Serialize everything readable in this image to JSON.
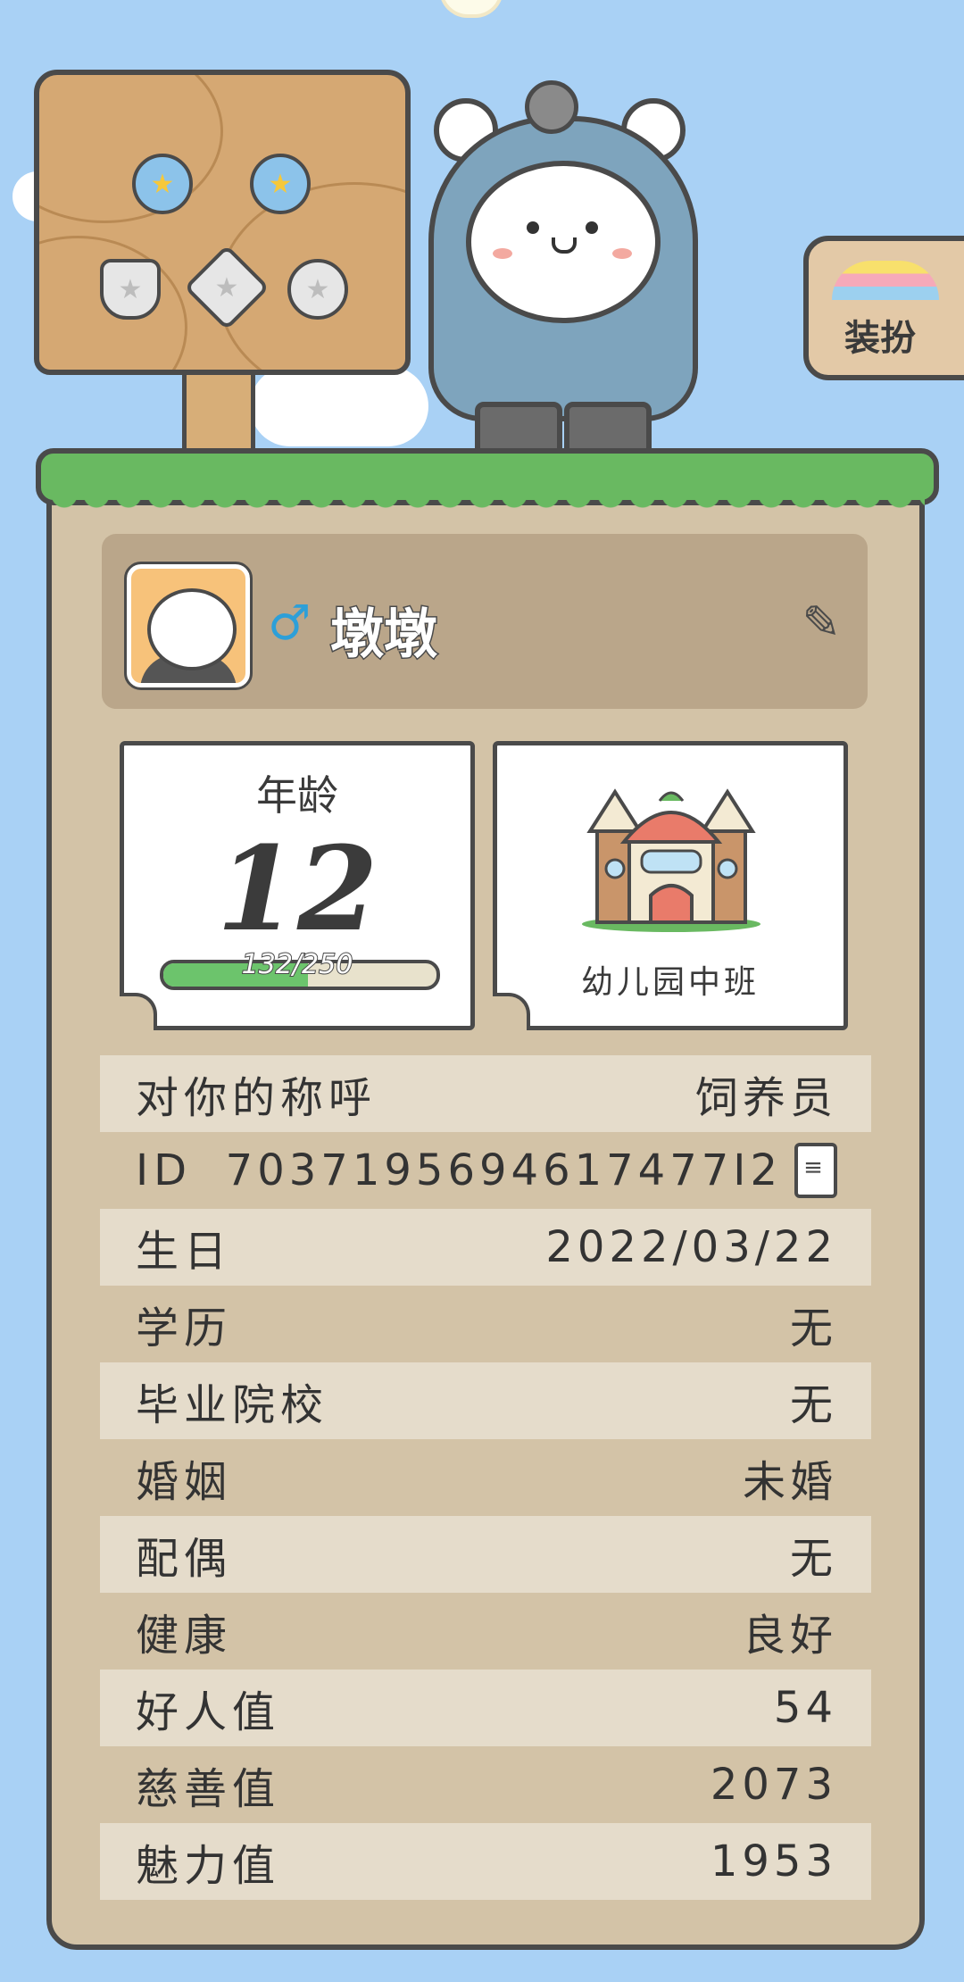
{
  "dress_up_button": {
    "label": "装扮"
  },
  "profile": {
    "nickname": "墩墩",
    "gender_symbol": "♂"
  },
  "age_tile": {
    "label": "年龄",
    "value": "12",
    "progress_text": "132/250",
    "progress_fraction": 0.528
  },
  "school_tile": {
    "label": "幼儿园中班"
  },
  "rows": [
    {
      "label": "对你的称呼",
      "value": "饲养员"
    },
    {
      "label": "ID",
      "value": "7037195694617477I2"
    },
    {
      "label": "生日",
      "value": "2022/03/22"
    },
    {
      "label": "学历",
      "value": "无"
    },
    {
      "label": "毕业院校",
      "value": "无"
    },
    {
      "label": "婚姻",
      "value": "未婚"
    },
    {
      "label": "配偶",
      "value": "无"
    },
    {
      "label": "健康",
      "value": "良好"
    },
    {
      "label": "好人值",
      "value": "54"
    },
    {
      "label": "慈善值",
      "value": "2073"
    },
    {
      "label": "魅力值",
      "value": "1953"
    }
  ],
  "icons": {
    "edit": "edit-pencil-icon",
    "copy": "copy-icon",
    "gender": "male-icon"
  },
  "colors": {
    "sky": "#a9d1f5",
    "card": "#d3c3a7",
    "grass": "#69b961",
    "progress": "#6cc46c",
    "gender": "#2d9fd8"
  }
}
